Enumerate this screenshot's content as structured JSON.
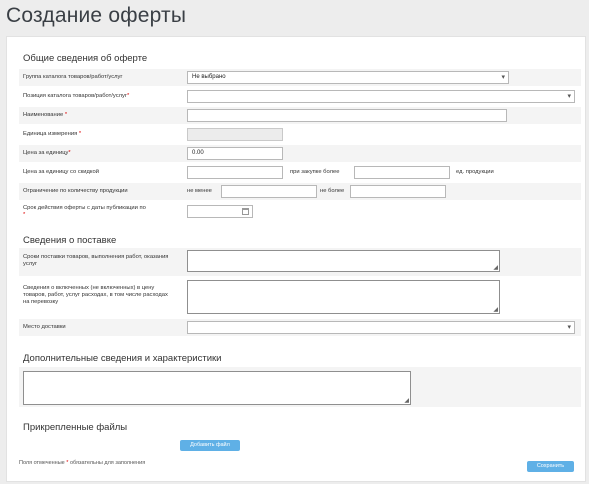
{
  "page": {
    "title": "Создание оферты"
  },
  "sections": {
    "general": "Общие сведения об оферте",
    "delivery": "Сведения о поставке",
    "additional": "Дополнительные сведения и характеристики",
    "files": "Прикрепленные файлы"
  },
  "fields": {
    "catalog_group": {
      "label": "Группа каталога товаров/работ/услуг",
      "value": "Не выбрано"
    },
    "catalog_position": {
      "label": "Позиция каталога товаров/работ/услуг",
      "value": ""
    },
    "name": {
      "label": "Наименование",
      "value": ""
    },
    "unit": {
      "label": "Единица измерения",
      "value": ""
    },
    "unit_price": {
      "label": "Цена за единицу",
      "value": "0.00"
    },
    "discount_price": {
      "label": "Цена за единицу со скидкой",
      "when_buying_more": "при закупке более",
      "units_suffix": "ед. продукции"
    },
    "quantity_limit": {
      "label": "Ограничение по количеству продукции",
      "min": "не менее",
      "max": "не более"
    },
    "validity": {
      "label": "Срок действия оферты с даты публикации по"
    },
    "delivery_terms": {
      "label": "Сроки поставки товаров, выполнения работ, оказания услуг"
    },
    "delivery_costs": {
      "label": "Сведения о включенных (не включенных) в цену товаров, работ, услуг расходах, в том числе расходах на перевозку"
    },
    "delivery_place": {
      "label": "Место доставки",
      "value": ""
    }
  },
  "required_mark": "*",
  "buttons": {
    "add_file": "Добавить файл",
    "save": "Сохранить"
  },
  "footnote": {
    "prefix": "Поля отмеченные",
    "suffix": "обязательны для заполнения"
  }
}
